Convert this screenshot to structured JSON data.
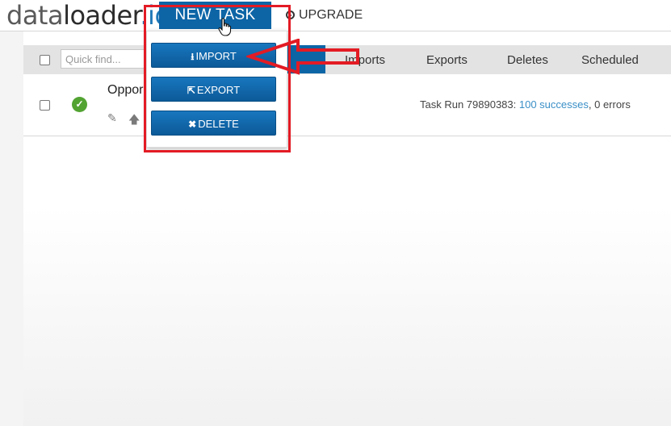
{
  "header": {
    "logo_part1": "data",
    "logo_part2": "loader",
    "logo_part3": ".io",
    "new_task_label": "NEW TASK",
    "upgrade_label": "UPGRADE"
  },
  "toolbar": {
    "search_placeholder": "Quick find...",
    "tabs": [
      "Imports",
      "Exports",
      "Deletes",
      "Scheduled"
    ]
  },
  "task_row": {
    "name": "Oppor",
    "run_text": "Task Run 79890383: ",
    "successes_link": "100 successes",
    "errors_text": ", 0 errors"
  },
  "dropdown": {
    "items": [
      {
        "label": "IMPORT",
        "icon": "download-icon"
      },
      {
        "label": "EXPORT",
        "icon": "export-icon"
      },
      {
        "label": "DELETE",
        "icon": "close-icon"
      }
    ]
  },
  "colors": {
    "brand_blue": "#0d65a6",
    "accent_blue": "#1e78b8",
    "success_green": "#52a332",
    "annotation_red": "#e31b24",
    "link_blue": "#3a8fc7"
  }
}
